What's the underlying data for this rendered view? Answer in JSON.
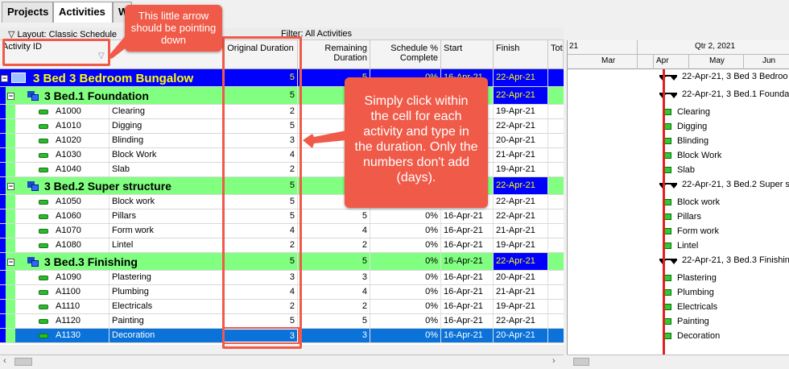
{
  "tabs": [
    {
      "label": "Projects"
    },
    {
      "label": "Activities"
    },
    {
      "label": "W"
    }
  ],
  "layout_label": "Layout: Classic Schedule",
  "filter_label": "Filter: All Activities",
  "columns": {
    "activity_id": "Activity ID",
    "original_duration": "Original Duration",
    "remaining_duration": "Remaining Duration",
    "schedule_pct": "Schedule % Complete",
    "start": "Start",
    "finish": "Finish",
    "total": "Tot"
  },
  "gantt_header": {
    "year_label": "21",
    "quarter_label": "Qtr 2, 2021",
    "months": [
      "Mar",
      "Apr",
      "May",
      "Jun"
    ]
  },
  "rows": [
    {
      "type": "project",
      "label": "3  Bed  3 Bedroom Bungalow",
      "od": "5",
      "rd": "5",
      "pct": "0%",
      "start": "16-Apr-21",
      "finish": "22-Apr-21"
    },
    {
      "type": "wbs",
      "label": "3  Bed.1  Foundation",
      "od": "5",
      "rd": "",
      "pct": "",
      "start": "",
      "finish": "22-Apr-21"
    },
    {
      "type": "act",
      "id": "A1000",
      "name": "Clearing",
      "od": "2",
      "rd": "",
      "pct": "",
      "start": "",
      "finish": "19-Apr-21"
    },
    {
      "type": "act",
      "id": "A1010",
      "name": "Digging",
      "od": "5",
      "rd": "",
      "pct": "",
      "start": "",
      "finish": "22-Apr-21"
    },
    {
      "type": "act",
      "id": "A1020",
      "name": "Blinding",
      "od": "3",
      "rd": "",
      "pct": "",
      "start": "",
      "finish": "20-Apr-21"
    },
    {
      "type": "act",
      "id": "A1030",
      "name": "Block Work",
      "od": "4",
      "rd": "",
      "pct": "",
      "start": "",
      "finish": "21-Apr-21"
    },
    {
      "type": "act",
      "id": "A1040",
      "name": "Slab",
      "od": "2",
      "rd": "",
      "pct": "",
      "start": "",
      "finish": "19-Apr-21"
    },
    {
      "type": "wbs",
      "label": "3  Bed.2  Super structure",
      "od": "5",
      "rd": "",
      "pct": "",
      "start": "",
      "finish": "22-Apr-21"
    },
    {
      "type": "act",
      "id": "A1050",
      "name": "Block work",
      "od": "5",
      "rd": "",
      "pct": "",
      "start": "",
      "finish": "22-Apr-21"
    },
    {
      "type": "act",
      "id": "A1060",
      "name": "Pillars",
      "od": "5",
      "rd": "5",
      "pct": "0%",
      "start": "16-Apr-21",
      "finish": "22-Apr-21"
    },
    {
      "type": "act",
      "id": "A1070",
      "name": "Form work",
      "od": "4",
      "rd": "4",
      "pct": "0%",
      "start": "16-Apr-21",
      "finish": "21-Apr-21"
    },
    {
      "type": "act",
      "id": "A1080",
      "name": "Lintel",
      "od": "2",
      "rd": "2",
      "pct": "0%",
      "start": "16-Apr-21",
      "finish": "19-Apr-21"
    },
    {
      "type": "wbs",
      "label": "3  Bed.3  Finishing",
      "od": "5",
      "rd": "5",
      "pct": "0%",
      "start": "16-Apr-21",
      "finish": "22-Apr-21"
    },
    {
      "type": "act",
      "id": "A1090",
      "name": "Plastering",
      "od": "3",
      "rd": "3",
      "pct": "0%",
      "start": "16-Apr-21",
      "finish": "20-Apr-21"
    },
    {
      "type": "act",
      "id": "A1100",
      "name": "Plumbing",
      "od": "4",
      "rd": "4",
      "pct": "0%",
      "start": "16-Apr-21",
      "finish": "21-Apr-21"
    },
    {
      "type": "act",
      "id": "A1110",
      "name": "Electricals",
      "od": "2",
      "rd": "2",
      "pct": "0%",
      "start": "16-Apr-21",
      "finish": "19-Apr-21"
    },
    {
      "type": "act",
      "id": "A1120",
      "name": "Painting",
      "od": "5",
      "rd": "5",
      "pct": "0%",
      "start": "16-Apr-21",
      "finish": "22-Apr-21"
    },
    {
      "type": "act",
      "id": "A1130",
      "name": "Decoration",
      "od": "3",
      "rd": "3",
      "pct": "0%",
      "start": "16-Apr-21",
      "finish": "20-Apr-21",
      "selected": true
    }
  ],
  "gantt_labels": [
    "22-Apr-21, 3  Bed  3 Bedroo",
    "22-Apr-21, 3  Bed.1  Founda",
    "Clearing",
    "Digging",
    "Blinding",
    "Block Work",
    "Slab",
    "22-Apr-21, 3  Bed.2  Super s",
    "Block work",
    "Pillars",
    "Form work",
    "Lintel",
    "22-Apr-21, 3  Bed.3  Finishin",
    "Plastering",
    "Plumbing",
    "Electricals",
    "Painting",
    "Decoration"
  ],
  "callouts": {
    "arrow_note": "This little arrow should be pointing down",
    "duration_note": "Simply click within the cell for each activity and type in the duration. Only the numbers don't add (days)."
  },
  "colors": {
    "project_row": "#0000ff",
    "wbs_row": "#80ff80",
    "selected_row": "#0a72d8",
    "callout": "#f05a48",
    "data_date_line": "#e02020"
  }
}
